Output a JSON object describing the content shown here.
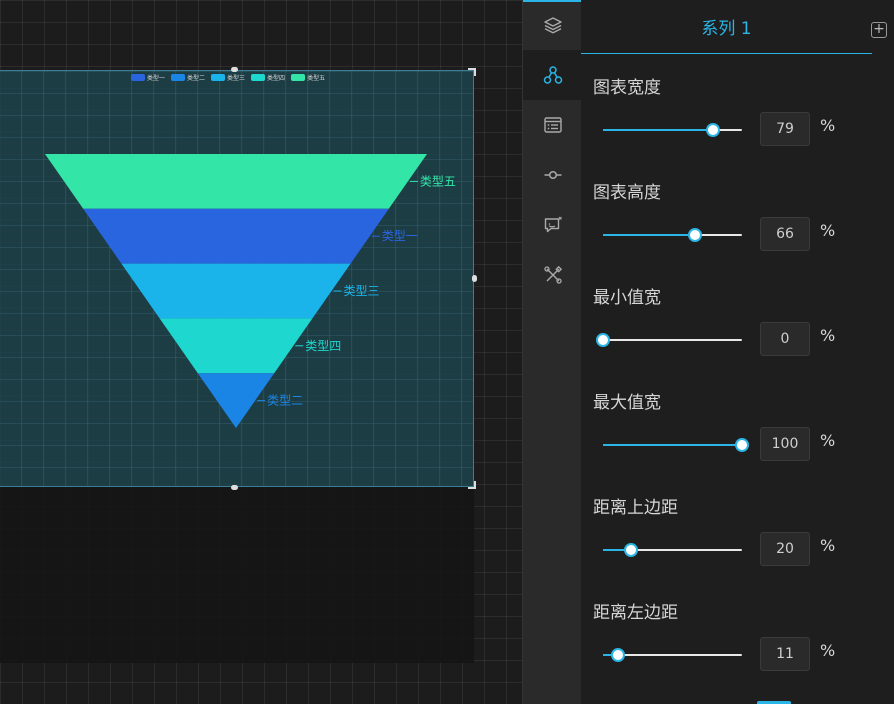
{
  "chart_data": {
    "type": "funnel",
    "legend": [
      "类型一",
      "类型二",
      "类型三",
      "类型四",
      "类型五"
    ],
    "legend_colors": [
      "#2a65e0",
      "#1b85e6",
      "#1ab3ea",
      "#1ed7cf",
      "#33e6a8"
    ],
    "slices": [
      {
        "name": "类型五",
        "color": "#33e6a8"
      },
      {
        "name": "类型一",
        "color": "#2a65e0"
      },
      {
        "name": "类型三",
        "color": "#1ab3ea"
      },
      {
        "name": "类型四",
        "color": "#1ed7cf"
      },
      {
        "name": "类型二",
        "color": "#1b85e6"
      }
    ]
  },
  "rail": {
    "items": [
      "layers-icon",
      "nodes-icon",
      "list-icon",
      "commit-icon",
      "comment-icon",
      "tools-icon"
    ],
    "active_index": 1
  },
  "panel": {
    "tab_label": "系列 1",
    "add_symbol": "+",
    "props": [
      {
        "label": "图表宽度",
        "value": 79,
        "unit": "%"
      },
      {
        "label": "图表高度",
        "value": 66,
        "unit": "%"
      },
      {
        "label": "最小值宽",
        "value": 0,
        "unit": "%"
      },
      {
        "label": "最大值宽",
        "value": 100,
        "unit": "%"
      },
      {
        "label": "距离上边距",
        "value": 20,
        "unit": "%"
      },
      {
        "label": "距离左边距",
        "value": 11,
        "unit": "%"
      }
    ]
  },
  "colors": {
    "accent": "#2ab5e6"
  }
}
